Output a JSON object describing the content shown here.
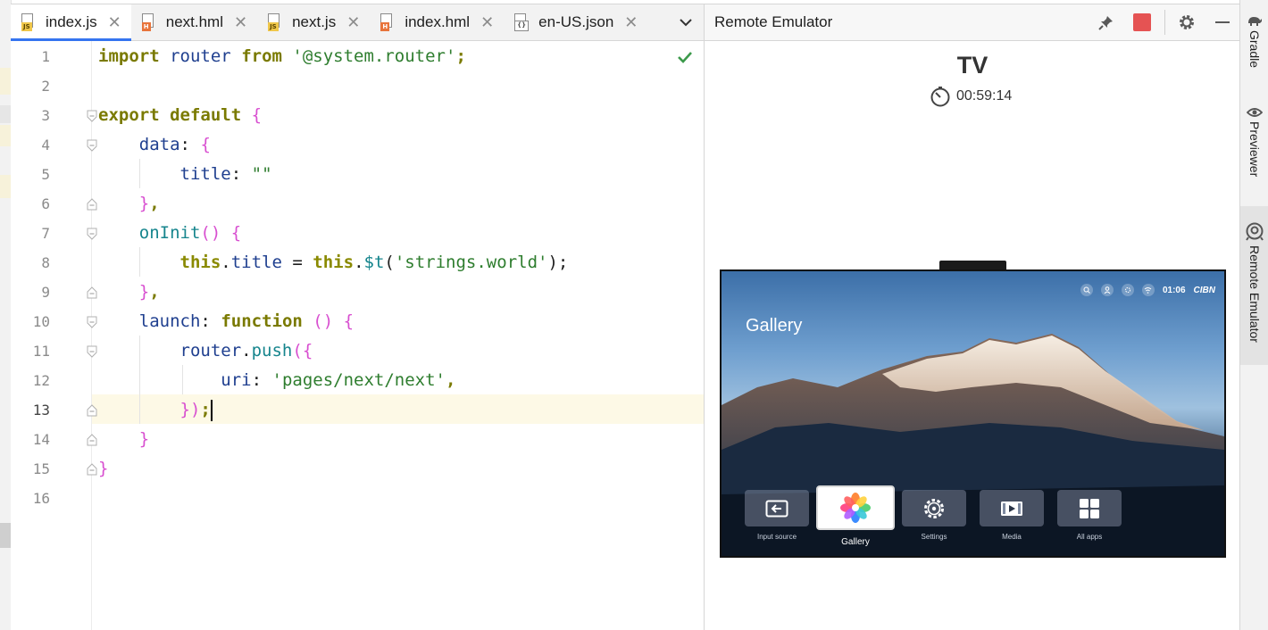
{
  "tabs": [
    {
      "name": "index.js",
      "type": "js",
      "active": true
    },
    {
      "name": "next.hml",
      "type": "hml",
      "active": false
    },
    {
      "name": "next.js",
      "type": "js",
      "active": false
    },
    {
      "name": "index.hml",
      "type": "hml",
      "active": false
    },
    {
      "name": "en-US.json",
      "type": "json",
      "active": false
    }
  ],
  "editor": {
    "line_numbers": [
      "1",
      "2",
      "3",
      "4",
      "5",
      "6",
      "7",
      "8",
      "9",
      "10",
      "11",
      "12",
      "13",
      "14",
      "15",
      "16"
    ],
    "current_line": 13,
    "status": "no-problems-check-icon"
  },
  "emulator": {
    "title": "Remote Emulator",
    "device": "TV",
    "timer": "00:59:14",
    "stop_color": "#e55353",
    "screen": {
      "clock": "01:06",
      "brand": "CIBN",
      "title": "Gallery",
      "apps": [
        {
          "label": "Input source",
          "icon": "input-source-icon"
        },
        {
          "label": "Gallery",
          "icon": "gallery-flower-icon",
          "focused": true
        },
        {
          "label": "Settings",
          "icon": "settings-gear-icon"
        },
        {
          "label": "Media",
          "icon": "media-play-icon"
        },
        {
          "label": "All apps",
          "icon": "all-apps-grid-icon"
        }
      ]
    }
  },
  "side_tools": [
    {
      "label": "Gradle",
      "icon": "gradle-elephant-icon"
    },
    {
      "label": "Previewer",
      "icon": "eye-icon"
    },
    {
      "label": "Remote Emulator",
      "icon": "remote-emulator-icon",
      "active": true
    }
  ]
}
